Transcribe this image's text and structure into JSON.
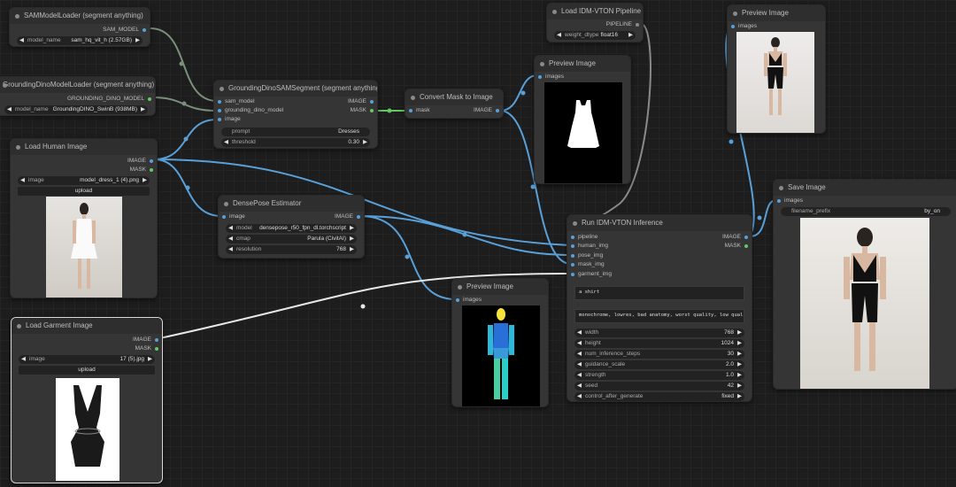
{
  "nodes": {
    "sam_loader": {
      "title": "SAMModelLoader (segment anything)",
      "output": "SAM_MODEL",
      "widget_label": "model_name",
      "widget_value": "sam_hq_vit_h (2.57GB)"
    },
    "gdino_loader": {
      "title": "GroundingDinoModelLoader (segment anything)",
      "output": "GROUNDING_DINO_MODEL",
      "widget_label": "model_name",
      "widget_value": "GroundingDINO_SwinB (938MB)"
    },
    "gdsam": {
      "title": "GroundingDinoSAMSegment (segment anything)",
      "inputs": [
        "sam_model",
        "grounding_dino_model",
        "image"
      ],
      "outputs": [
        "IMAGE",
        "MASK"
      ],
      "prompt_label": "prompt",
      "prompt_value": "Dresses",
      "threshold_label": "threshold",
      "threshold_value": "0.30"
    },
    "convert_mask": {
      "title": "Convert Mask to Image",
      "input": "mask",
      "output": "IMAGE"
    },
    "idm_pipeline": {
      "title": "Load IDM-VTON Pipeline",
      "output": "PIPELINE",
      "widget_label": "weight_dtype",
      "widget_value": "float16"
    },
    "preview_top": {
      "title": "Preview Image",
      "input": "images"
    },
    "preview_mask": {
      "title": "Preview Image",
      "input": "images"
    },
    "load_human": {
      "title": "Load Human Image",
      "outputs": [
        "IMAGE",
        "MASK"
      ],
      "widget_label": "image",
      "widget_value": "model_dress_1 (4).png",
      "upload": "upload"
    },
    "densepose": {
      "title": "DensePose Estimator",
      "input": "image",
      "output": "IMAGE",
      "model_label": "model",
      "model_value": "densepose_r50_fpn_dl.torchscript",
      "cmap_label": "cmap",
      "cmap_value": "Parula (CivitAI)",
      "res_label": "resolution",
      "res_value": "768"
    },
    "run_idm": {
      "title": "Run IDM-VTON Inference",
      "inputs": [
        "pipeline",
        "human_img",
        "pose_img",
        "mask_img",
        "garment_img"
      ],
      "outputs": [
        "IMAGE",
        "MASK"
      ],
      "prompt": "a shirt",
      "negative": "monochrome, lowres, bad anatomy, worst quality, low quality",
      "params": [
        {
          "label": "width",
          "value": "768"
        },
        {
          "label": "height",
          "value": "1024"
        },
        {
          "label": "num_inference_steps",
          "value": "30"
        },
        {
          "label": "guidance_scale",
          "value": "2.0"
        },
        {
          "label": "strength",
          "value": "1.0"
        },
        {
          "label": "seed",
          "value": "42"
        },
        {
          "label": "control_after_generate",
          "value": "fixed"
        }
      ]
    },
    "preview_pose": {
      "title": "Preview Image",
      "input": "images"
    },
    "save_image": {
      "title": "Save Image",
      "input": "images",
      "widget_label": "filename_prefix",
      "widget_value": "by_on"
    },
    "load_garment": {
      "title": "Load Garment Image",
      "outputs": [
        "IMAGE",
        "MASK"
      ],
      "widget_label": "image",
      "widget_value": "17 (5).jpg",
      "upload": "upload"
    }
  },
  "colors": {
    "canvas": "#1d1d1d",
    "node_body": "#353535",
    "wire_image": "#5aa0d8",
    "wire_model": "#7b8f7b",
    "wire_mask": "#64c864",
    "wire_white": "#e8e8e8"
  }
}
